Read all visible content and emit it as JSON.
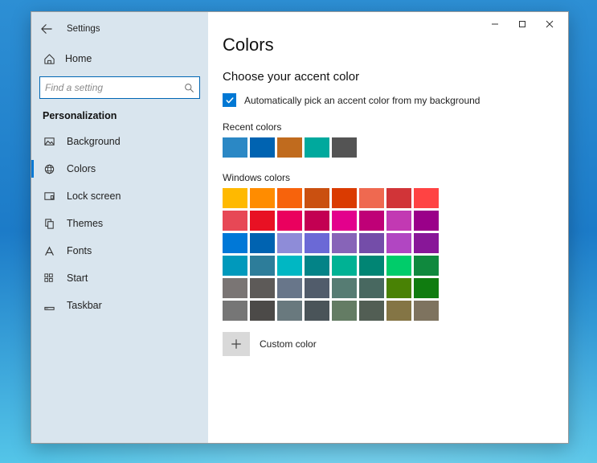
{
  "app_title": "Settings",
  "window_controls": {
    "min": "—",
    "max": "☐",
    "close": "✕"
  },
  "sidebar": {
    "home_label": "Home",
    "search_placeholder": "Find a setting",
    "section_label": "Personalization",
    "items": [
      {
        "label": "Background"
      },
      {
        "label": "Colors"
      },
      {
        "label": "Lock screen"
      },
      {
        "label": "Themes"
      },
      {
        "label": "Fonts"
      },
      {
        "label": "Start"
      },
      {
        "label": "Taskbar"
      }
    ],
    "active_index": 1
  },
  "main": {
    "page_title": "Colors",
    "subheading": "Choose your accent color",
    "auto_checkbox_label": "Automatically pick an accent color from my background",
    "auto_checked": true,
    "recent_label": "Recent colors",
    "recent_colors": [
      "#2b88c5",
      "#0063b1",
      "#c06b1e",
      "#00a99d",
      "#545454"
    ],
    "windows_label": "Windows colors",
    "windows_colors": [
      "#ffb900",
      "#ff8c00",
      "#f7630c",
      "#ca5010",
      "#da3b01",
      "#ef6950",
      "#d13438",
      "#ff4343",
      "#e74856",
      "#e81123",
      "#ea005e",
      "#c30052",
      "#e3008c",
      "#bf0077",
      "#c239b3",
      "#9a0089",
      "#0078d7",
      "#0063b1",
      "#8e8cd8",
      "#6b69d6",
      "#8764b8",
      "#744da9",
      "#b146c2",
      "#881798",
      "#0099bc",
      "#2d7d9a",
      "#00b7c3",
      "#038387",
      "#00b294",
      "#018574",
      "#00cc6a",
      "#10893e",
      "#7a7574",
      "#5d5a58",
      "#68768a",
      "#515c6b",
      "#567c73",
      "#486860",
      "#498205",
      "#107c10",
      "#767676",
      "#4c4a48",
      "#69797e",
      "#4a5459",
      "#647c64",
      "#525e54",
      "#847545",
      "#7e735f"
    ],
    "custom_label": "Custom color"
  }
}
